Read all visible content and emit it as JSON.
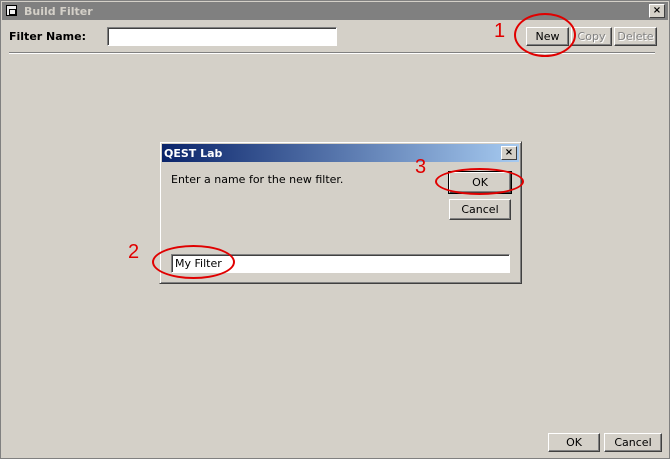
{
  "window": {
    "title": "Build Filter",
    "close_label": "×"
  },
  "filter": {
    "label": "Filter Name:",
    "value": ""
  },
  "toolbar": {
    "new_label": "New",
    "copy_label": "Copy",
    "delete_label": "Delete"
  },
  "footer": {
    "ok_label": "OK",
    "cancel_label": "Cancel"
  },
  "dialog": {
    "title": "QEST Lab",
    "close_label": "×",
    "prompt": "Enter a name for the new filter.",
    "ok_label": "OK",
    "cancel_label": "Cancel",
    "input_value": "My Filter"
  },
  "annotations": {
    "step1": "1",
    "step2": "2",
    "step3": "3",
    "color": "#e00000"
  },
  "colors": {
    "face": "#d4d0c8",
    "inactive_title": "#808080",
    "active_title_start": "#0a246a",
    "active_title_end": "#a6caf0"
  },
  "icons": {
    "window_icon": "form-window-icon",
    "close": "close-icon"
  }
}
